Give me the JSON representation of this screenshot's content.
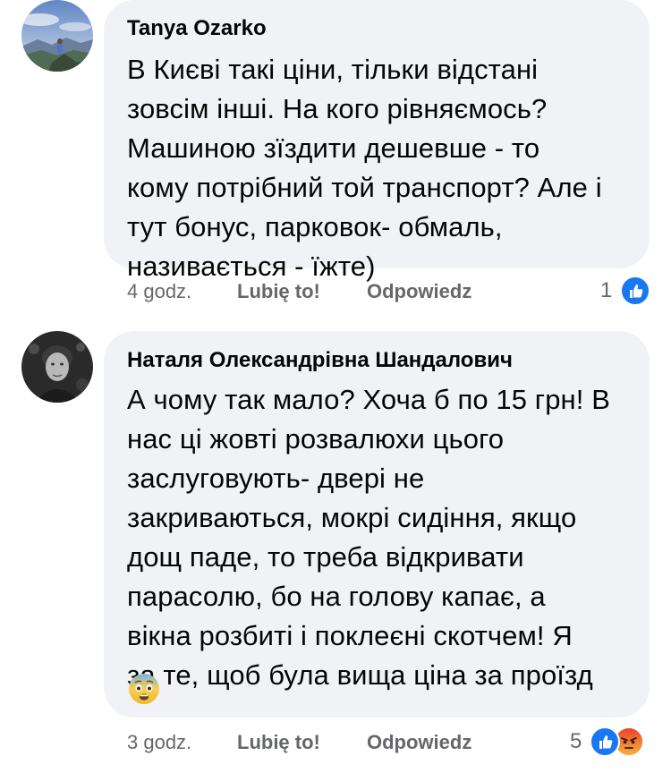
{
  "comments": [
    {
      "author": "Tanya Ozarko",
      "lines": [
        "В Києві такі ціни, тільки відстані",
        "зовсім інші. На кого рівняємось?",
        "Машиною зїздити дешевше - то",
        "кому потрібний той транспорт? Але і",
        "тут бонус, парковок- обмаль,",
        "називається - їжте)"
      ],
      "time": "4 godz.",
      "like_label": "Lubię to!",
      "reply_label": "Odpowiedz",
      "reaction_count": "1",
      "reactions": [
        "like-icon"
      ]
    },
    {
      "author": "Наталя Олександрівна Шандалович",
      "lines": [
        "А чому так мало? Хоча б по 15 грн! В",
        "нас ці жовті розвалюхи цього",
        "заслуговують- двері не",
        "закриваються, мокрі сидіння, якщо",
        "дощ паде, то треба відкривати",
        "парасолю, бо на голову капає, а",
        "вікна розбиті і поклеєні скотчем! Я",
        "за те, щоб була вища ціна за проїзд"
      ],
      "emoji": "fearful-face-emoji",
      "time": "3 godz.",
      "like_label": "Lubię to!",
      "reply_label": "Odpowiedz",
      "reaction_count": "5",
      "reactions": [
        "like-icon",
        "angry-icon"
      ]
    }
  ],
  "colors": {
    "bubble": "#f0f2f5",
    "meta_text": "#65676b",
    "like_blue": "#1877f2",
    "angry_orange": "#f0673a"
  }
}
